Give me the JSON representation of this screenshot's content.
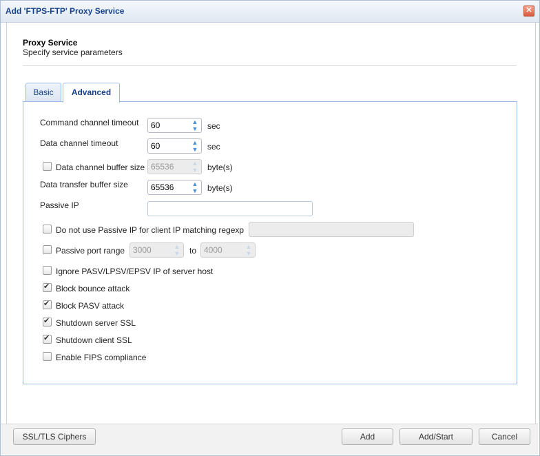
{
  "window": {
    "title": "Add 'FTPS-FTP' Proxy Service",
    "close_icon": "close-icon"
  },
  "header": {
    "title": "Proxy Service",
    "subtitle": "Specify service parameters"
  },
  "tabs": [
    {
      "label": "Basic",
      "active": false
    },
    {
      "label": "Advanced",
      "active": true
    }
  ],
  "advanced": {
    "command_channel_timeout": {
      "label": "Command channel timeout",
      "value": "60",
      "unit": "sec"
    },
    "data_channel_timeout": {
      "label": "Data channel timeout",
      "value": "60",
      "unit": "sec"
    },
    "data_channel_buffer_size": {
      "label": "Data channel buffer size",
      "value": "65536",
      "unit": "byte(s)",
      "checked": false,
      "disabled": true
    },
    "data_transfer_buffer_size": {
      "label": "Data transfer buffer size",
      "value": "65536",
      "unit": "byte(s)"
    },
    "passive_ip": {
      "label": "Passive IP",
      "value": ""
    },
    "no_passive_ip_regexp": {
      "label": "Do not use Passive IP for client IP matching regexp",
      "value": "",
      "checked": false
    },
    "passive_port_range": {
      "label": "Passive port range",
      "from": "3000",
      "to_label": "to",
      "to": "4000",
      "checked": false
    },
    "checkboxes": [
      {
        "label": "Ignore PASV/LPSV/EPSV IP of server host",
        "checked": false
      },
      {
        "label": "Block bounce attack",
        "checked": true
      },
      {
        "label": "Block PASV attack",
        "checked": true
      },
      {
        "label": "Shutdown server SSL",
        "checked": true
      },
      {
        "label": "Shutdown client SSL",
        "checked": true
      },
      {
        "label": "Enable FIPS compliance",
        "checked": false
      }
    ]
  },
  "footer": {
    "ssl_ciphers": "SSL/TLS Ciphers",
    "add": "Add",
    "add_start": "Add/Start",
    "cancel": "Cancel"
  }
}
